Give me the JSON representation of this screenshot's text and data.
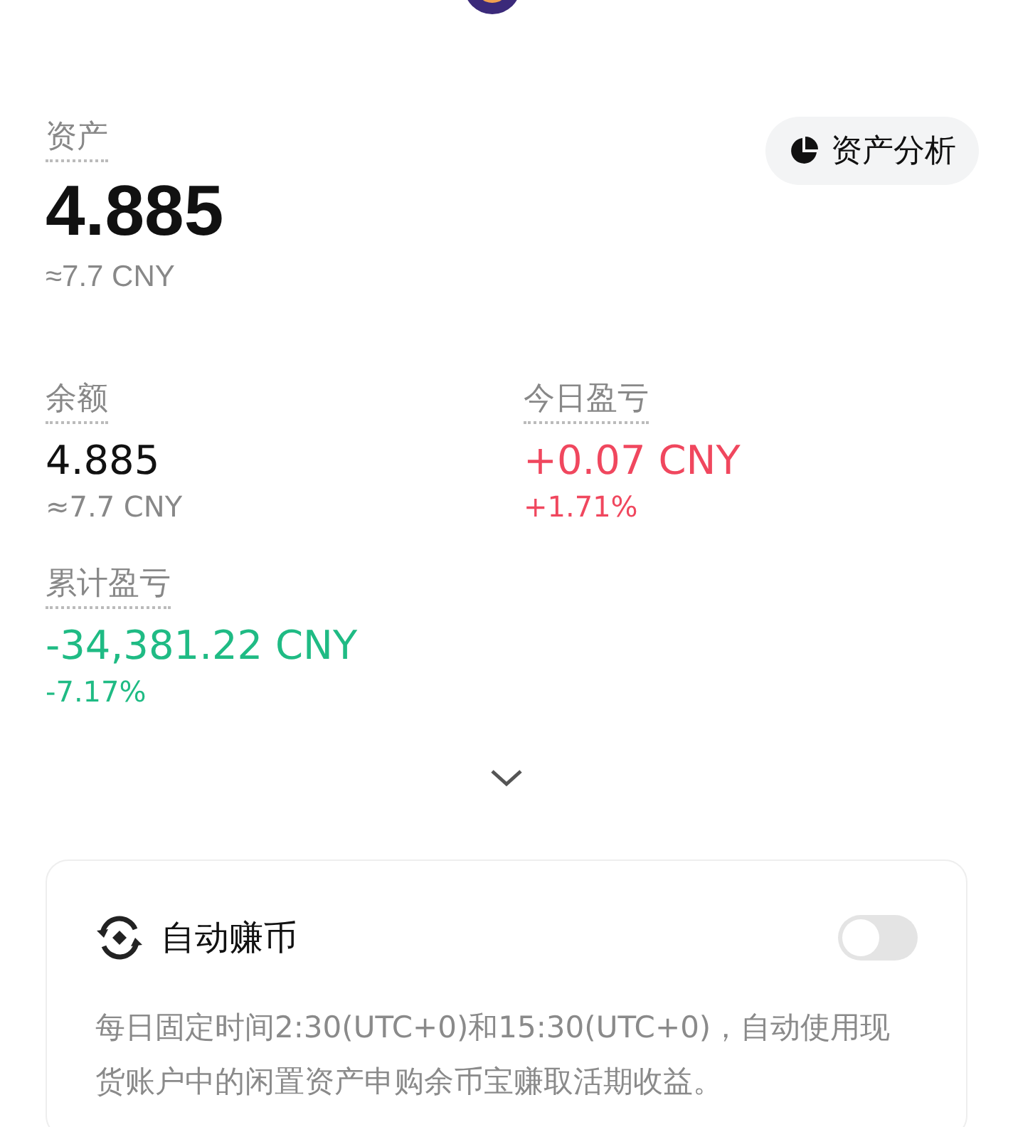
{
  "assets": {
    "label": "资产",
    "value": "4.885",
    "approx": "≈7.7 CNY",
    "analysis_button": "资产分析"
  },
  "stats": [
    {
      "label": "余额",
      "value": "4.885",
      "sub": "≈7.7 CNY",
      "color": "#111111"
    },
    {
      "label": "今日盈亏",
      "value": "+0.07 CNY",
      "sub": "+1.71%",
      "color": "#f0475e"
    },
    {
      "label": "累计盈亏",
      "value": "-34,381.22 CNY",
      "sub": "-7.17%",
      "color": "#1fbb84"
    }
  ],
  "auto_earn": {
    "title": "自动赚币",
    "on": false,
    "description": "每日固定时间2:30(UTC+0)和15:30(UTC+0)，自动使用现货账户中的闲置资产申购余币宝赚取活期收益。"
  }
}
